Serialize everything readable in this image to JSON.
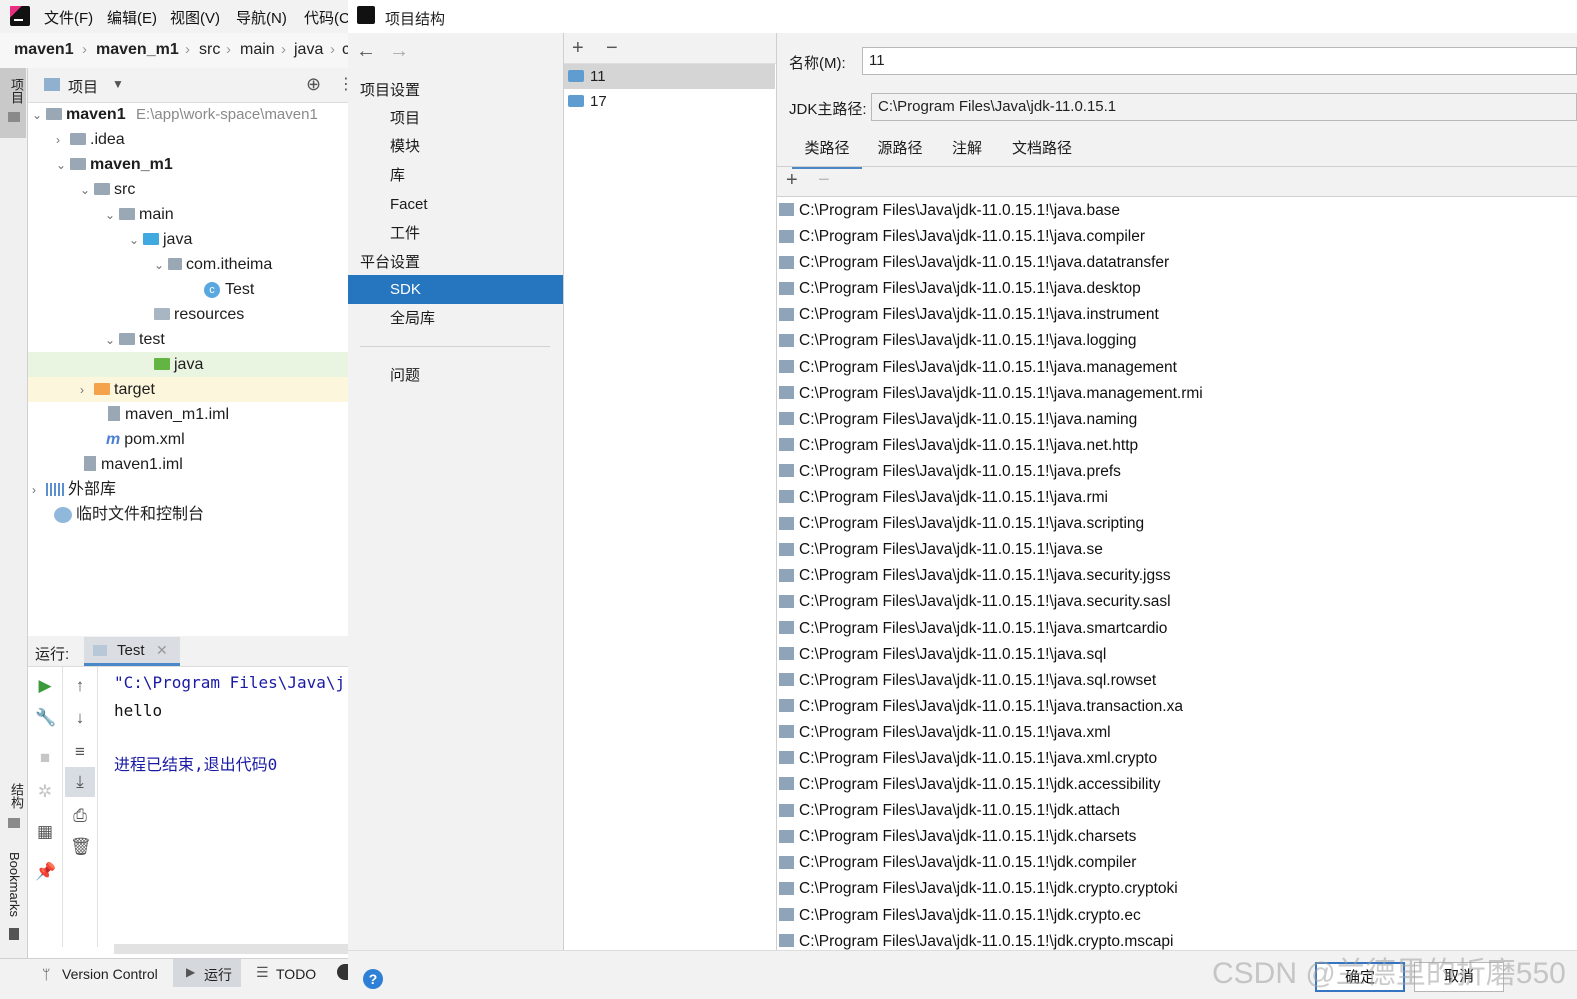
{
  "ide": {
    "menus": [
      "文件(F)",
      "编辑(E)",
      "视图(V)",
      "导航(N)",
      "代码(C"
    ],
    "breadcrumb": [
      "maven1",
      "maven_m1",
      "src",
      "main",
      "java",
      "c"
    ],
    "left_tabs": [
      "项目",
      "结构",
      "Bookmarks"
    ],
    "project_panel": {
      "title": "项目"
    },
    "tree": [
      {
        "label": "maven1",
        "path": "E:\\app\\work-space\\maven1",
        "bold": true,
        "icon": "folder-icon"
      },
      {
        "label": ".idea",
        "icon": "folder-icon"
      },
      {
        "label": "maven_m1",
        "bold": true,
        "icon": "folder-icon"
      },
      {
        "label": "src",
        "icon": "folder-icon"
      },
      {
        "label": "main",
        "icon": "folder-icon"
      },
      {
        "label": "java",
        "icon": "source-folder-icon"
      },
      {
        "label": "com.itheima",
        "icon": "package-icon"
      },
      {
        "label": "Test",
        "icon": "java-class-icon"
      },
      {
        "label": "resources",
        "icon": "resources-folder-icon"
      },
      {
        "label": "test",
        "icon": "folder-icon"
      },
      {
        "label": "java",
        "icon": "test-folder-icon"
      },
      {
        "label": "target",
        "icon": "excluded-folder-icon"
      },
      {
        "label": "maven_m1.iml",
        "icon": "iml-file-icon"
      },
      {
        "label": "pom.xml",
        "icon": "maven-icon"
      },
      {
        "label": "maven1.iml",
        "icon": "iml-file-icon"
      },
      {
        "label": "外部库",
        "icon": "library-icon"
      },
      {
        "label": "临时文件和控制台",
        "icon": "scratch-icon"
      }
    ],
    "run_panel": {
      "label": "运行:",
      "tab": "Test",
      "console_lines": [
        "\"C:\\Program Files\\Java\\j",
        "hello",
        "",
        "进程已结束,退出代码0"
      ]
    },
    "status_tabs": [
      "Version Control",
      "运行",
      "TODO"
    ]
  },
  "dialog": {
    "title": "项目结构",
    "nav": {
      "section1": "项目设置",
      "items1": [
        "项目",
        "模块",
        "库",
        "Facet",
        "工件"
      ],
      "section2": "平台设置",
      "items2": [
        "SDK",
        "全局库"
      ],
      "problems": "问题",
      "selected": "SDK"
    },
    "sdks": [
      "11",
      "17"
    ],
    "selected_sdk": "11",
    "name_label": "名称(M):",
    "name_value": "11",
    "home_label": "JDK主路径:",
    "home_value": "C:\\Program Files\\Java\\jdk-11.0.15.1",
    "tabs": [
      "类路径",
      "源路径",
      "注解",
      "文档路径"
    ],
    "selected_tab": "类路径",
    "classpath": [
      "C:\\Program Files\\Java\\jdk-11.0.15.1!\\java.base",
      "C:\\Program Files\\Java\\jdk-11.0.15.1!\\java.compiler",
      "C:\\Program Files\\Java\\jdk-11.0.15.1!\\java.datatransfer",
      "C:\\Program Files\\Java\\jdk-11.0.15.1!\\java.desktop",
      "C:\\Program Files\\Java\\jdk-11.0.15.1!\\java.instrument",
      "C:\\Program Files\\Java\\jdk-11.0.15.1!\\java.logging",
      "C:\\Program Files\\Java\\jdk-11.0.15.1!\\java.management",
      "C:\\Program Files\\Java\\jdk-11.0.15.1!\\java.management.rmi",
      "C:\\Program Files\\Java\\jdk-11.0.15.1!\\java.naming",
      "C:\\Program Files\\Java\\jdk-11.0.15.1!\\java.net.http",
      "C:\\Program Files\\Java\\jdk-11.0.15.1!\\java.prefs",
      "C:\\Program Files\\Java\\jdk-11.0.15.1!\\java.rmi",
      "C:\\Program Files\\Java\\jdk-11.0.15.1!\\java.scripting",
      "C:\\Program Files\\Java\\jdk-11.0.15.1!\\java.se",
      "C:\\Program Files\\Java\\jdk-11.0.15.1!\\java.security.jgss",
      "C:\\Program Files\\Java\\jdk-11.0.15.1!\\java.security.sasl",
      "C:\\Program Files\\Java\\jdk-11.0.15.1!\\java.smartcardio",
      "C:\\Program Files\\Java\\jdk-11.0.15.1!\\java.sql",
      "C:\\Program Files\\Java\\jdk-11.0.15.1!\\java.sql.rowset",
      "C:\\Program Files\\Java\\jdk-11.0.15.1!\\java.transaction.xa",
      "C:\\Program Files\\Java\\jdk-11.0.15.1!\\java.xml",
      "C:\\Program Files\\Java\\jdk-11.0.15.1!\\java.xml.crypto",
      "C:\\Program Files\\Java\\jdk-11.0.15.1!\\jdk.accessibility",
      "C:\\Program Files\\Java\\jdk-11.0.15.1!\\jdk.attach",
      "C:\\Program Files\\Java\\jdk-11.0.15.1!\\jdk.charsets",
      "C:\\Program Files\\Java\\jdk-11.0.15.1!\\jdk.compiler",
      "C:\\Program Files\\Java\\jdk-11.0.15.1!\\jdk.crypto.cryptoki",
      "C:\\Program Files\\Java\\jdk-11.0.15.1!\\jdk.crypto.ec",
      "C:\\Program Files\\Java\\jdk-11.0.15.1!\\jdk.crypto.mscapi"
    ],
    "buttons": {
      "ok": "确定",
      "cancel": "取消",
      "help": "?"
    }
  },
  "watermark": "CSDN @兰德里的折磨550",
  "colors": {
    "selection": "#2675bf",
    "accent": "#3574c2",
    "source_folder": "#40a9e0",
    "test_folder": "#62b543",
    "excluded_folder": "#f4a34b"
  }
}
